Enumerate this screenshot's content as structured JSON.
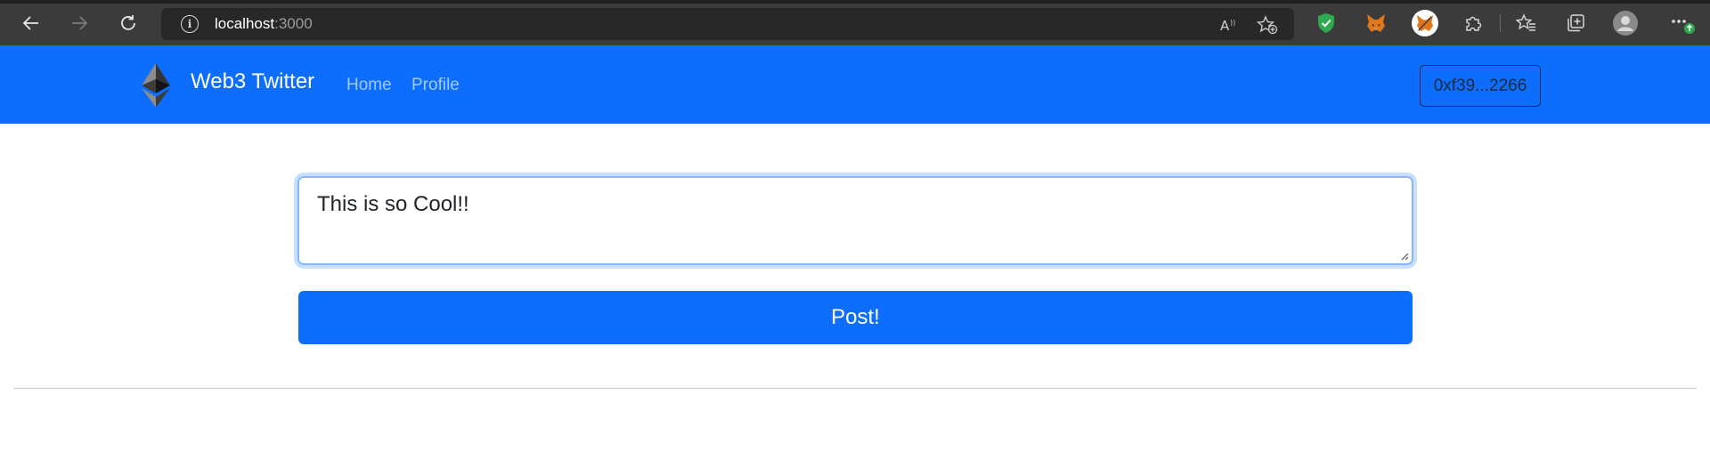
{
  "browser": {
    "address": {
      "host": "localhost",
      "port": ":3000"
    },
    "icons": {
      "back": "back-arrow-icon",
      "forward": "forward-arrow-icon",
      "refresh": "refresh-icon",
      "site_info": "info-icon",
      "read_aloud": "read-aloud-icon",
      "add_favorite": "add-favorite-icon",
      "extensions": [
        "shield-extension-icon",
        "metamask-fox-icon",
        "metamask-profile-icon",
        "puzzle-extensions-icon"
      ],
      "favorites": "favorites-icon",
      "collections": "collections-icon",
      "profile": "profile-avatar-icon",
      "menu": "more-menu-icon"
    }
  },
  "navbar": {
    "brand": "Web3 Twitter",
    "links": [
      "Home",
      "Profile"
    ],
    "wallet": "0xf39...2266",
    "color": "#0d6efd"
  },
  "composer": {
    "text": "This is so Cool!!",
    "post_label": "Post!"
  }
}
